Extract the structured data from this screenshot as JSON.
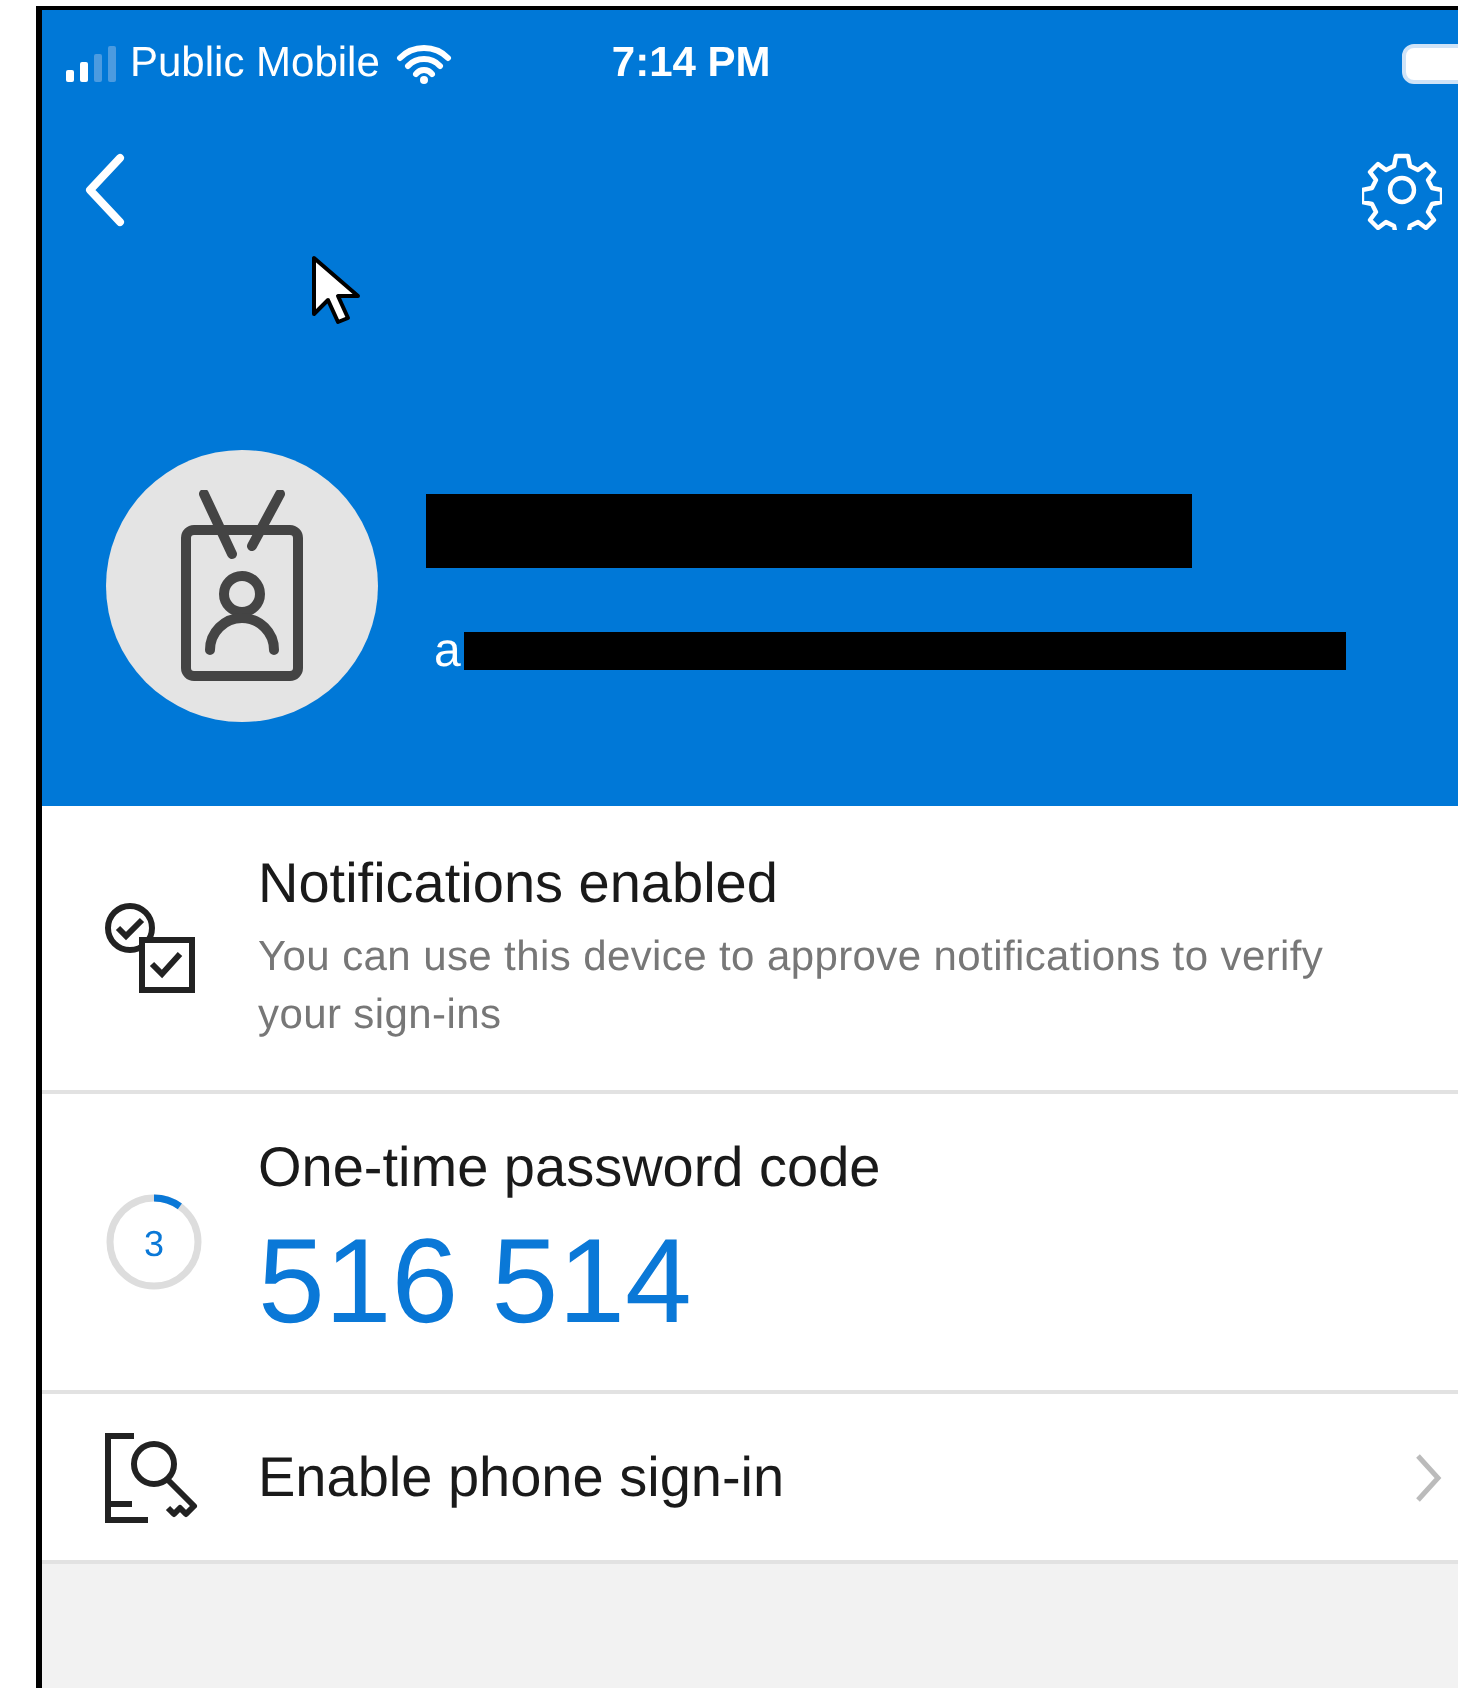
{
  "status_bar": {
    "carrier": "Public Mobile",
    "time": "7:14 PM"
  },
  "profile": {
    "email": "a"
  },
  "items": [
    {
      "kind": "notifications",
      "title": "Notifications enabled",
      "subtitle": "You can use this device to approve notifications to verify your sign-ins"
    },
    {
      "kind": "otp",
      "title": "One-time password code",
      "code": "516 514",
      "seconds": "3"
    },
    {
      "kind": "phone",
      "title": "Enable phone sign-in"
    }
  ]
}
